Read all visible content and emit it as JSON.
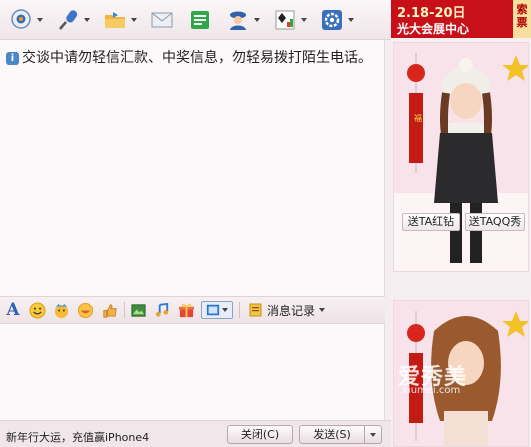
{
  "toolbar": {
    "tools": [
      {
        "name": "video-call",
        "icon": "webcam-icon"
      },
      {
        "name": "voice-call",
        "icon": "microphone-icon"
      },
      {
        "name": "send-file",
        "icon": "folder-icon"
      },
      {
        "name": "send-mail",
        "icon": "envelope-icon"
      },
      {
        "name": "app",
        "icon": "app-icon"
      },
      {
        "name": "contacts",
        "icon": "user-icon"
      },
      {
        "name": "games",
        "icon": "cards-icon"
      },
      {
        "name": "settings",
        "icon": "gear-icon"
      }
    ]
  },
  "messages": {
    "notice": "交谈中请勿轻信汇款、中奖信息，勿轻易拨打陌生电话。"
  },
  "input_toolbar": {
    "font_label": "A",
    "history_label": "消息记录"
  },
  "status_bar": {
    "promo_text": "新年行大运，充值赢iPhone4",
    "close_label": "关闭(C)",
    "send_label": "发送(S)"
  },
  "ad": {
    "date": "2.18-20日",
    "title": "光大会展中心",
    "tag": "索票"
  },
  "show": {
    "send_red_diamond": "送TA红钻",
    "send_qq_show": "送TAQQ秀",
    "watermark": "爱秀美",
    "watermark_url": "xiumei.com"
  },
  "colors": {
    "accent_blue": "#2b62b5",
    "ad_red": "#c8101a",
    "panel_bg": "#f6eef0"
  }
}
